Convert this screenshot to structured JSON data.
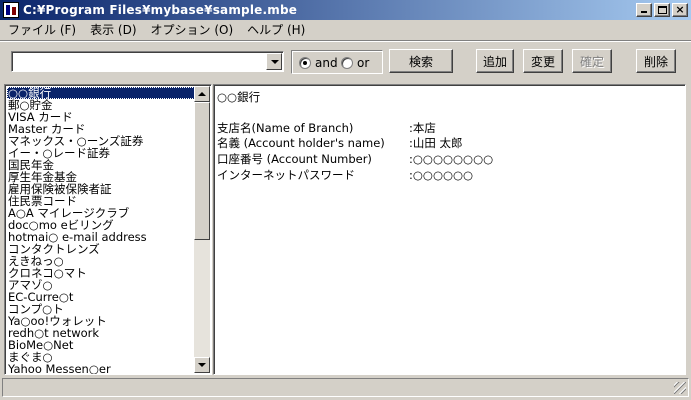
{
  "window": {
    "title": "C:¥Program Files¥mybase¥sample.mbe"
  },
  "menu": [
    {
      "label": "ファイル (F)"
    },
    {
      "label": "表示 (D)"
    },
    {
      "label": "オプション (O)"
    },
    {
      "label": "ヘルプ (H)"
    }
  ],
  "search": {
    "value": ""
  },
  "search_mode": {
    "and_label": "and",
    "or_label": "or",
    "selected": "and"
  },
  "buttons": {
    "search": "検索",
    "add": "追加",
    "edit": "変更",
    "confirm": "確定",
    "delete": "削除"
  },
  "list": [
    "○○銀行",
    "郵○貯金",
    "VISA カード",
    "Master カード",
    "マネックス・○ーンズ証券",
    "イー・○レード証券",
    "国民年金",
    "厚生年金基金",
    "雇用保険被保険者証",
    "住民票コード",
    "A○A マイレージクラブ",
    "doc○mo eビリング",
    "hotmai○ e-mail address",
    "コンタクトレンズ",
    "えきねっ○",
    "クロネコ○マト",
    "アマゾ○",
    "EC-Curre○t",
    "コンプ○ト",
    "Ya○oo!ウォレット",
    "redh○t network",
    "BioMe○Net",
    "まぐま○",
    "Yahoo Messen○er"
  ],
  "detail": {
    "title": "○○銀行",
    "fields": [
      {
        "label": "支店名(Name of Branch)",
        "value": ":本店"
      },
      {
        "label": "名義 (Account holder's name)",
        "value": ":山田 太郎"
      },
      {
        "label": "口座番号 (Account Number)",
        "value": ":○○○○○○○○"
      },
      {
        "label": "インターネットパスワード",
        "value": ":○○○○○○"
      }
    ]
  },
  "colors": {
    "face": "#d4d0c8",
    "title_start": "#0a246a",
    "title_end": "#a6caf0",
    "selection": "#0a246a"
  }
}
